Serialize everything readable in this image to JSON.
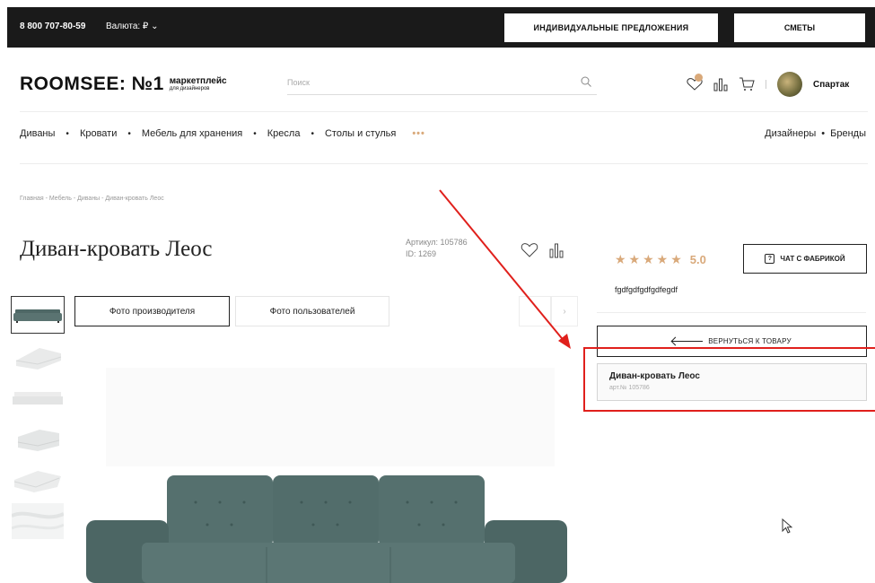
{
  "topbar": {
    "phone": "8 800 707-80-59",
    "currency": "Валюта: ₽ ⌄",
    "offers_label": "ИНДИВИДУАЛЬНЫЕ ПРЕДЛОЖЕНИЯ",
    "estimates_label": "СМЕТЫ"
  },
  "header": {
    "logo_main": "ROOMSEE: №1",
    "logo_tag_1": "маркетплейс",
    "logo_tag_2": "для дизайнеров",
    "search_placeholder": "Поиск",
    "user_name": "Спартак"
  },
  "nav": {
    "items": [
      "Диваны",
      "Кровати",
      "Мебель для хранения",
      "Кресла",
      "Столы и стулья"
    ],
    "more": "•••",
    "right_items": [
      "Дизайнеры",
      "Бренды"
    ]
  },
  "breadcrumb": "Главная - Мебель - Диваны - Диван-кровать Леос",
  "product": {
    "title": "Диван-кровать Леос",
    "article": "Артикул: 105786",
    "id": "ID: 1269",
    "stars": "★★★★★",
    "rating": "5.0",
    "chat_label": "ЧАТ С ФАБРИКОЙ",
    "description": "fgdfgdfgdfgdfegdf"
  },
  "gallery": {
    "tab_manufacturer": "Фото производителя",
    "tab_users": "Фото пользователей",
    "next_label": "›"
  },
  "side": {
    "back_label": "ВЕРНУТЬСЯ К ТОВАРУ",
    "card_name": "Диван-кровать Леос",
    "card_article": "арт.№ 105786"
  },
  "colors": {
    "accent": "#d9a97a",
    "dark": "#1a1a1a",
    "annotation": "#e0201c",
    "sofa": "#4f6866"
  }
}
